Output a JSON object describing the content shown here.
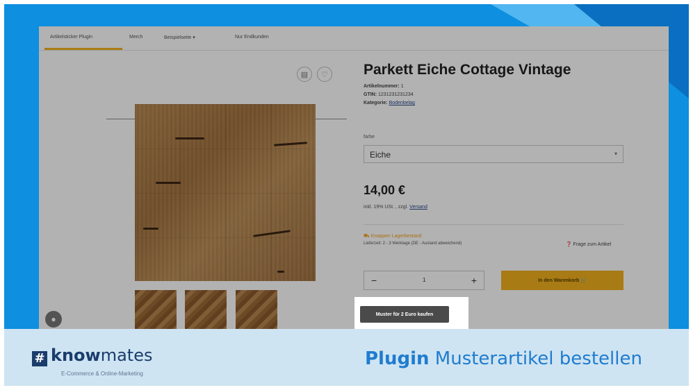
{
  "topnav": {
    "items": [
      "Artikelsticker Plugin",
      "Merch",
      "Beispielseite ▾",
      "Nur Endkunden"
    ]
  },
  "product": {
    "title": "Parkett Eiche Cottage Vintage",
    "article_label": "Artikelnummer:",
    "article_value": "1",
    "gtin_label": "GTIN:",
    "gtin_value": "1231231231234",
    "category_label": "Kategorie:",
    "category_value": "Bodenbelag",
    "color_label": "farbe",
    "color_value": "Eiche",
    "price": "14,00 €",
    "tax_text": "inkl. 19% USt. , zzgl.",
    "shipping_link": "Versand",
    "stock_text": "Knappen Lagerbestand",
    "delivery_text": "Lieferzeit: 2 - 3 Werktage (DE - Ausland abweichend)",
    "question_text": "Frage zum Artikel",
    "qty_minus": "−",
    "qty_value": "1",
    "qty_plus": "+",
    "cart_label": "In den Warenkorb 🛒",
    "sample_button": "Muster für 2 Euro kaufen"
  },
  "icons": {
    "compare": "▤",
    "wishlist": "♡",
    "chat": "●",
    "stock": "⛟",
    "question": "❓"
  },
  "footer": {
    "logo_hash": "#",
    "logo_strong": "know",
    "logo_light": "mates",
    "tagline": "E-Commerce & Online-Marketing",
    "title_strong": "Plugin",
    "title_rest": " Musterartikel bestellen"
  },
  "colors": {
    "background_blue": "#0e8fe0",
    "accent_yellow": "#f2b01e",
    "footer_bg": "#cfe4f2",
    "brand_navy": "#1b3d6d",
    "title_blue": "#1f7ccf"
  }
}
